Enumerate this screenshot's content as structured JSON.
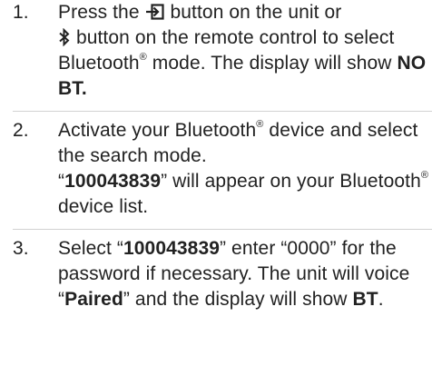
{
  "steps": [
    {
      "number": "1.",
      "parts": [
        "Press the",
        "button on the unit or",
        "button on the remote control to select Bluetooth",
        "®",
        "mode. The display will show",
        "NO BT."
      ],
      "icons": [
        "source-input-icon",
        "bluetooth-icon"
      ]
    },
    {
      "number": "2.",
      "parts": [
        "Activate your Bluetooth",
        "®",
        "device and select the search mode.",
        "“",
        "100043839",
        "” will appear on your Bluetooth",
        "®",
        "device list."
      ]
    },
    {
      "number": "3.",
      "parts": [
        "Select “",
        "100043839",
        "” enter “0000” for the password if necessary. The unit will voice “",
        "Paired",
        "” and the display will show",
        "BT",
        "."
      ]
    }
  ]
}
